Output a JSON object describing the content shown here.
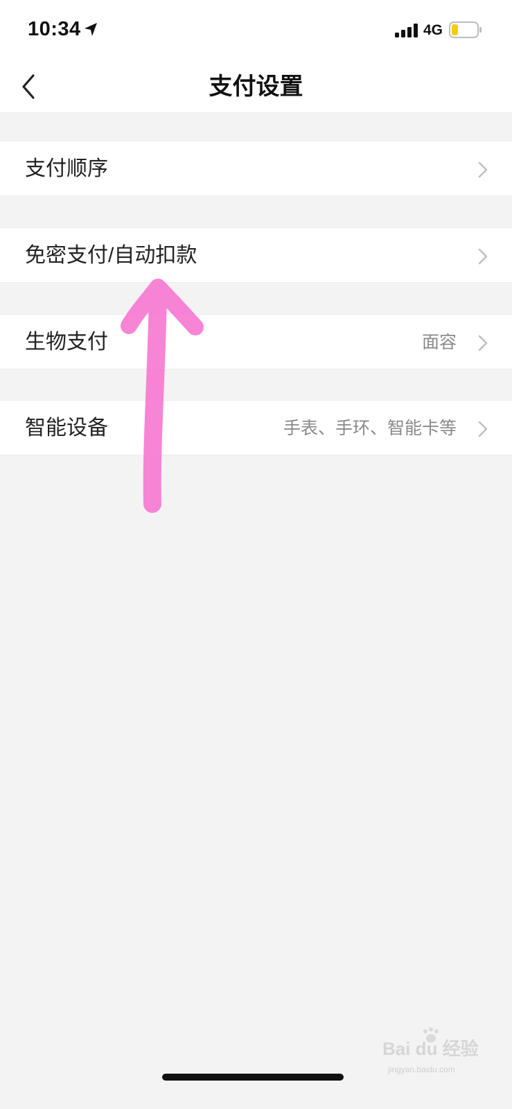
{
  "status_bar": {
    "time": "10:34",
    "network": "4G",
    "icons": [
      "location-arrow-icon",
      "signal-bars-icon",
      "battery-icon"
    ],
    "battery_level": 0.2
  },
  "nav": {
    "back_icon": "chevron-left-icon",
    "title": "支付设置"
  },
  "menu": [
    {
      "label": "支付顺序",
      "value": ""
    },
    {
      "label": "免密支付/自动扣款",
      "value": ""
    },
    {
      "label": "生物支付",
      "value": "面容"
    },
    {
      "label": "智能设备",
      "value": "手表、手环、智能卡等"
    }
  ],
  "annotation": {
    "type": "arrow",
    "direction": "up",
    "color": "#f77ad2"
  },
  "watermark": {
    "text": "Bai du 经验",
    "url": "jingyan.baidu.com"
  },
  "colors": {
    "background": "#f3f3f3",
    "card": "#ffffff",
    "text": "#222222",
    "secondary_text": "#8a8a8a",
    "battery_fill": "#f5cd0a"
  }
}
